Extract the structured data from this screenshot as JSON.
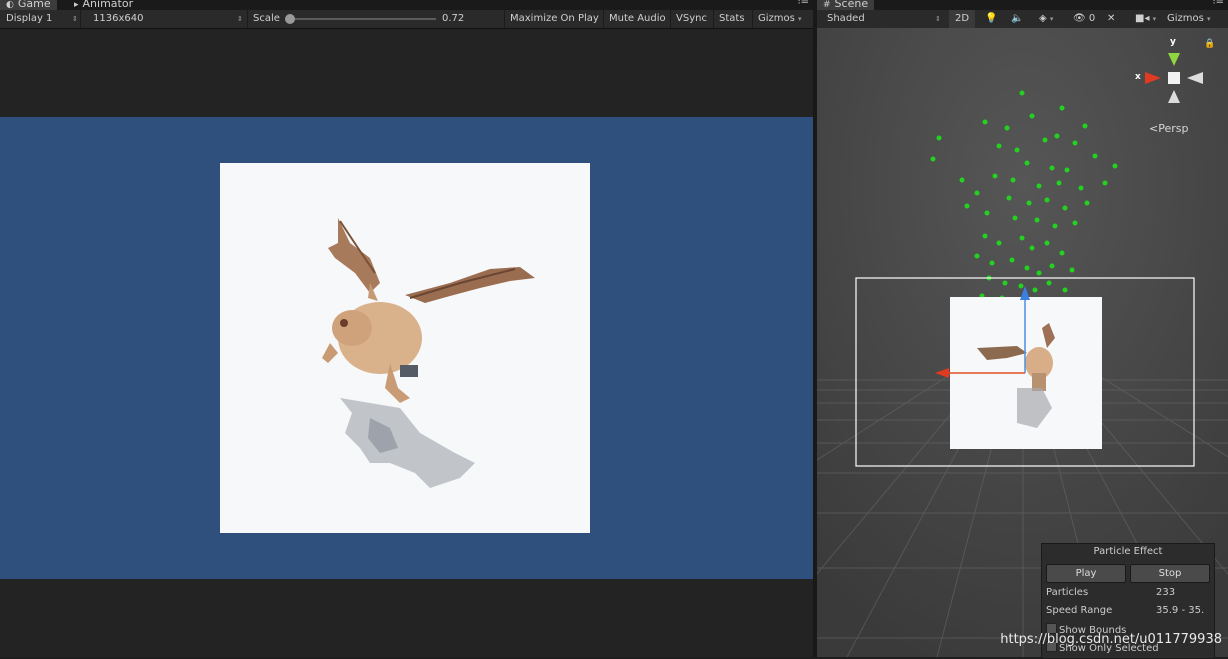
{
  "game": {
    "tab_label": "Game",
    "second_tab_label": "Animator",
    "display": "Display 1",
    "resolution": "1136x640",
    "scale_label": "Scale",
    "scale_value": "0.72",
    "maximize_on_play": "Maximize On Play",
    "mute_audio": "Mute Audio",
    "vsync": "VSync",
    "stats": "Stats",
    "gizmos": "Gizmos",
    "background_color": "#2f4f7d"
  },
  "scene": {
    "tab_label": "Scene",
    "shading": "Shaded",
    "mode_2d": "2D",
    "hidden_count": "0",
    "gizmos": "Gizmos",
    "projection": "Persp",
    "axis_x": "x",
    "axis_y": "y"
  },
  "particle_effect": {
    "title": "Particle Effect",
    "play": "Play",
    "stop": "Stop",
    "particles_label": "Particles",
    "particles_value": "233",
    "speed_label": "Speed Range",
    "speed_value": "35.9 - 35.",
    "show_bounds": "Show Bounds",
    "show_only_selected": "Show Only Selected"
  },
  "watermark": "https://blog.csdn.net/u011779938",
  "icons": {
    "game_tab": "game-controller-icon",
    "animator_tab": "animator-icon",
    "scene_tab": "scene-grid-icon",
    "menu": "panel-menu-icon",
    "light": "light-bulb-icon",
    "audio": "audio-speaker-icon",
    "effects": "effects-layers-icon",
    "visibility": "eye-visibility-icon",
    "tools": "tools-icon",
    "camera": "camera-icon",
    "lock": "lock-icon"
  }
}
